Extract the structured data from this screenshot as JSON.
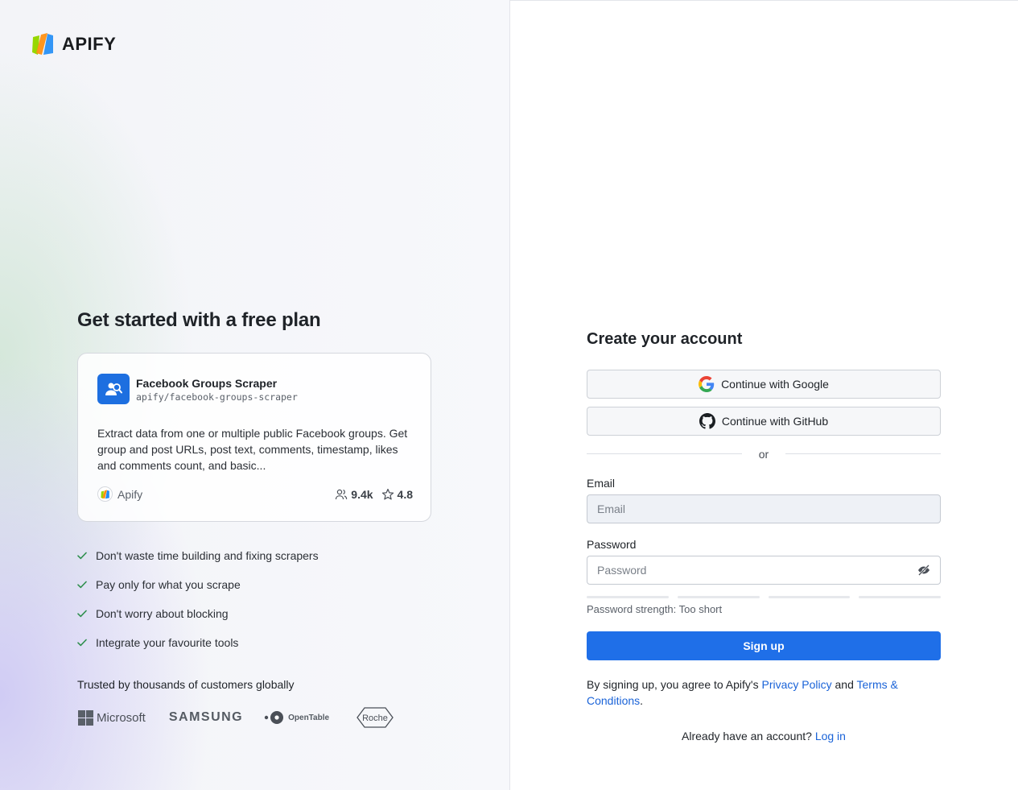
{
  "brand": {
    "name": "APIFY"
  },
  "left": {
    "title": "Get started with a free plan",
    "card": {
      "name": "Facebook Groups Scraper",
      "slug": "apify/facebook-groups-scraper",
      "description": "Extract data from one or multiple public Facebook groups. Get group and post URLs, post text, comments, timestamp, likes and comments count, and basic...",
      "author": "Apify",
      "users": "9.4k",
      "rating": "4.8"
    },
    "benefits": [
      "Don't waste time building and fixing scrapers",
      "Pay only for what you scrape",
      "Don't worry about blocking",
      "Integrate your favourite tools"
    ],
    "trusted": "Trusted by thousands of customers globally",
    "customer_logos": {
      "microsoft": "Microsoft",
      "samsung": "SAMSUNG",
      "opentable": "OpenTable",
      "roche": "Roche"
    }
  },
  "form": {
    "title": "Create your account",
    "google_label": "Continue with Google",
    "github_label": "Continue with GitHub",
    "divider": "or",
    "email_label": "Email",
    "email_placeholder": "Email",
    "email_value": "",
    "password_label": "Password",
    "password_placeholder": "Password",
    "password_value": "",
    "strength_text": "Password strength: Too short",
    "signup_label": "Sign up",
    "terms_prefix": "By signing up, you agree to Apify's ",
    "privacy_link": "Privacy Policy",
    "terms_and": " and ",
    "terms_link": "Terms & Conditions",
    "terms_suffix": ".",
    "login_prefix": "Already have an account? ",
    "login_link": "Log in"
  },
  "colors": {
    "primary": "#1f6fe8",
    "link": "#1a63d8",
    "check": "#2f8f4e",
    "card_icon": "#1d6fe0"
  }
}
